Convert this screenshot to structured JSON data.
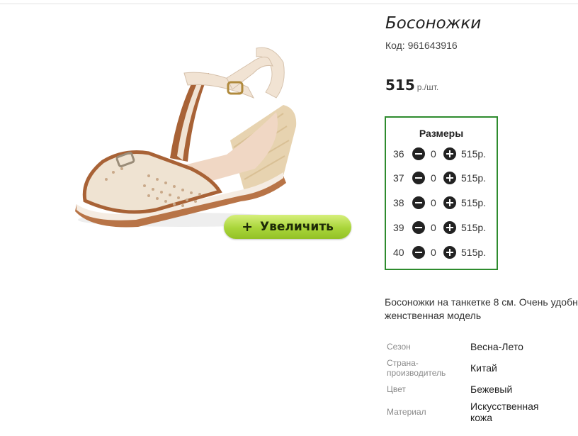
{
  "product": {
    "title": "Босоножки",
    "code": "Код: 961643916",
    "price": "515",
    "price_unit": "р./шт.",
    "image_name": "beige-brown-wedge-sandal"
  },
  "zoom": {
    "icon": "+",
    "label": "Увеличить"
  },
  "sizes": {
    "title": "Размеры",
    "rows": [
      {
        "size": "36",
        "qty": "0",
        "price": "515р."
      },
      {
        "size": "37",
        "qty": "0",
        "price": "515р."
      },
      {
        "size": "38",
        "qty": "0",
        "price": "515р."
      },
      {
        "size": "39",
        "qty": "0",
        "price": "515р."
      },
      {
        "size": "40",
        "qty": "0",
        "price": "515р."
      }
    ]
  },
  "description": {
    "line1": "Босоножки на танкетке 8 см. Очень удобн",
    "line2": "женственная модель"
  },
  "specs": [
    {
      "label": "Сезон",
      "value": "Весна-Лето"
    },
    {
      "label_line1": "Страна-",
      "label_line2": "производитель",
      "value": "Китай"
    },
    {
      "label": "Цвет",
      "value": "Бежевый"
    },
    {
      "label": "Материал",
      "value_line1": "Искусственная",
      "value_line2": "кожа"
    }
  ],
  "colors": {
    "sizes_border": "#2e8b2e",
    "zoom_button": "#a9d53a"
  }
}
